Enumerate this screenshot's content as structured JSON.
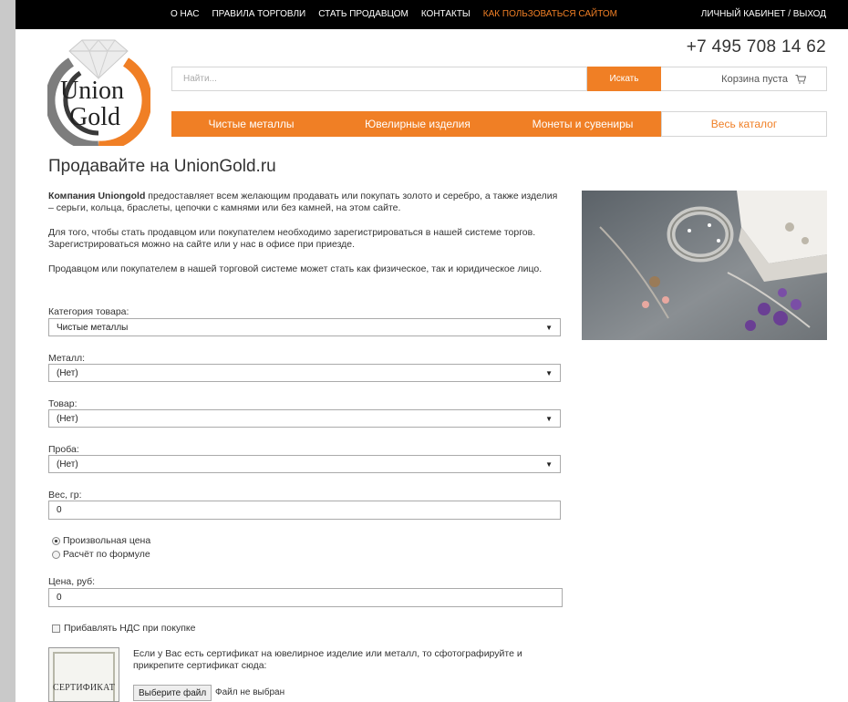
{
  "topbar": {
    "nav": [
      "О нас",
      "Правила торговли",
      "Стать продавцом",
      "Контакты",
      "Как пользоваться сайтом"
    ],
    "active_index": 4,
    "account": "Личный кабинет / Выход"
  },
  "logo": {
    "line1": "Union",
    "line2": "Gold"
  },
  "phone": "+7 495 708 14 62",
  "search": {
    "placeholder": "Найти...",
    "button": "Искать"
  },
  "cart": {
    "label": "Корзина пуста"
  },
  "catnav": [
    "Чистые металлы",
    "Ювелирные изделия",
    "Монеты и сувениры",
    "Весь каталог"
  ],
  "page_title": "Продавайте на UnionGold.ru",
  "intro": {
    "company": "Компания Uniongold",
    "p1_rest": " предоставляет всем желающим продавать или покупать золото и серебро, а также изделия – серьги, кольца, браслеты, цепочки с камнями или без камней, на этом сайте.",
    "p2": "Для того, чтобы стать продавцом или покупателем необходимо зарегистрироваться в нашей системе торгов. Зарегистрироваться можно на сайте или у нас в офисе при приезде.",
    "p3": "Продавцом или покупателем в нашей торговой системе может стать как физическое, так и юридическое лицо."
  },
  "form": {
    "category": {
      "label": "Категория товара:",
      "value": "Чистые металлы"
    },
    "metal": {
      "label": "Металл:",
      "value": "(Нет)"
    },
    "product": {
      "label": "Товар:",
      "value": "(Нет)"
    },
    "purity": {
      "label": "Проба:",
      "value": "(Нет)"
    },
    "weight": {
      "label": "Вес, гр:",
      "value": "0"
    },
    "price_mode": {
      "option1": "Произвольная цена",
      "option2": "Расчёт по формуле",
      "selected": 1
    },
    "price": {
      "label": "Цена, руб:",
      "value": "0"
    },
    "vat": {
      "label": "Прибавлять НДС при покупке",
      "checked": false
    }
  },
  "certificate": {
    "image_text": "СЕРТИФИКАТ",
    "description": "Если у Вас есть сертификат на ювелирное изделие или металл, то сфотографируйте и прикрепите сертификат сюда:",
    "button": "Выберите файл",
    "status": "Файл не выбран"
  }
}
